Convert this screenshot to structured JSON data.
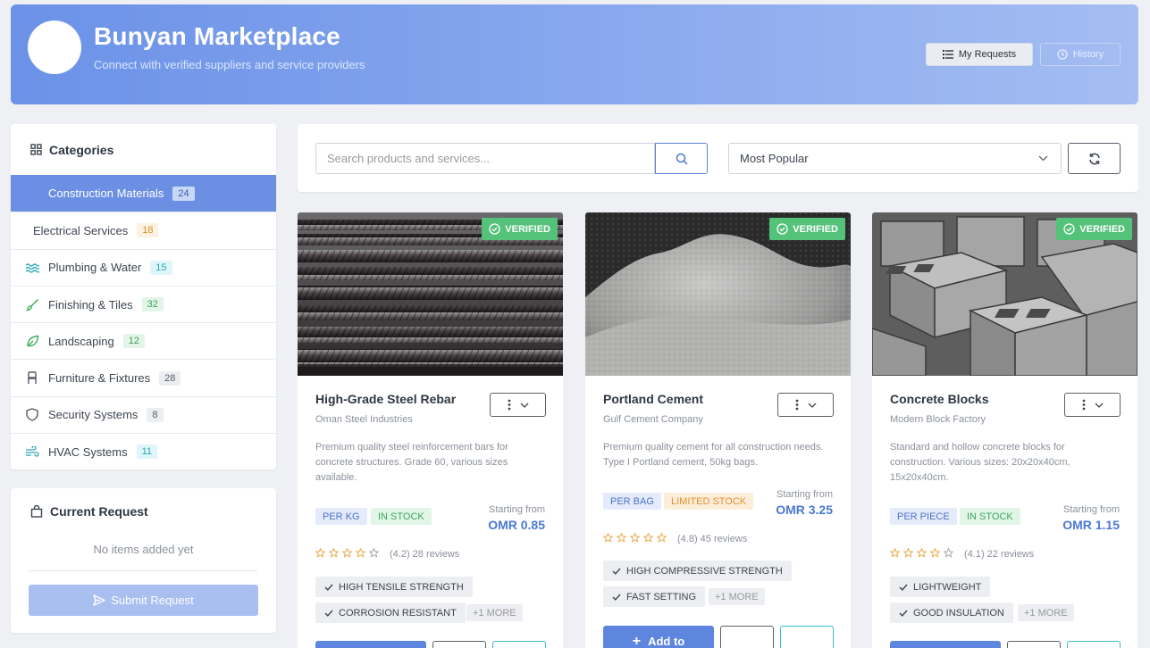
{
  "header": {
    "title": "Bunyan Marketplace",
    "subtitle": "Connect with verified suppliers and service providers",
    "my_requests_label": "My Requests",
    "history_label": "History"
  },
  "sidebar": {
    "title": "Categories",
    "items": [
      {
        "label": "Construction Materials",
        "count": "24",
        "active": true
      },
      {
        "label": "Electrical Services",
        "count": "18"
      },
      {
        "label": "Plumbing & Water",
        "count": "15",
        "icon": "water-waves-icon"
      },
      {
        "label": "Finishing & Tiles",
        "count": "32",
        "icon": "brush-icon"
      },
      {
        "label": "Landscaping",
        "count": "12",
        "icon": "leaf-icon"
      },
      {
        "label": "Furniture & Fixtures",
        "count": "28",
        "icon": "chair-icon"
      },
      {
        "label": "Security Systems",
        "count": "8",
        "icon": "shield-icon"
      },
      {
        "label": "HVAC Systems",
        "count": "11",
        "icon": "wind-icon"
      }
    ]
  },
  "request": {
    "title": "Current Request",
    "empty_text": "No items added yet",
    "submit_label": "Submit Request"
  },
  "toolbar": {
    "search_placeholder": "Search products and services...",
    "sort_value": "Most Popular"
  },
  "products": [
    {
      "verified_label": "VERIFIED",
      "title": "High-Grade Steel Rebar",
      "supplier": "Oman Steel Industries",
      "description": "Premium quality steel reinforcement bars for concrete structures. Grade 60, various sizes available.",
      "unit": "PER KG",
      "stock": "IN STOCK",
      "price_label": "Starting from",
      "price": "OMR 0.85",
      "rating": 4.2,
      "rating_text": "(4.2) 28 reviews",
      "features": [
        "HIGH TENSILE STRENGTH",
        "CORROSION RESISTANT"
      ],
      "more": "+1 MORE"
    },
    {
      "verified_label": "VERIFIED",
      "title": "Portland Cement",
      "supplier": "Gulf Cement Company",
      "description": "Premium quality cement for all construction needs. Type I Portland cement, 50kg bags.",
      "unit": "PER BAG",
      "stock": "LIMITED STOCK",
      "price_label": "Starting from",
      "price": "OMR 3.25",
      "rating": 4.8,
      "rating_text": "(4.8) 45 reviews",
      "features": [
        "HIGH COMPRESSIVE STRENGTH",
        "FAST SETTING"
      ],
      "more": "+1 MORE",
      "add_label": "Add to"
    },
    {
      "verified_label": "VERIFIED",
      "title": "Concrete Blocks",
      "supplier": "Modern Block Factory",
      "description": "Standard and hollow concrete blocks for construction. Various sizes: 20x20x40cm, 15x20x40cm.",
      "unit": "PER PIECE",
      "stock": "IN STOCK",
      "price_label": "Starting from",
      "price": "OMR 1.15",
      "rating": 4.1,
      "rating_text": "(4.1) 22 reviews",
      "features": [
        "LIGHTWEIGHT",
        "GOOD INSULATION"
      ],
      "more": "+1 MORE"
    }
  ],
  "colors": {
    "accent": "#6b8fe2",
    "verified": "#55c27a",
    "price": "#4a78d6"
  }
}
